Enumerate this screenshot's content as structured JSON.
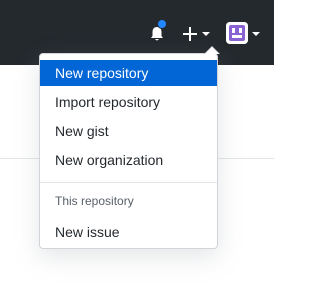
{
  "colors": {
    "topbar_bg": "#24292e",
    "accent": "#0366d6",
    "notification_dot": "#2188ff"
  },
  "header_icons": [
    "bell-icon",
    "plus-icon",
    "chevron-down-icon",
    "avatar"
  ],
  "menu": {
    "items": [
      {
        "label": "New repository",
        "active": true
      },
      {
        "label": "Import repository"
      },
      {
        "label": "New gist"
      },
      {
        "label": "New organization"
      }
    ],
    "section_header": "This repository",
    "section_items": [
      {
        "label": "New issue"
      }
    ]
  }
}
